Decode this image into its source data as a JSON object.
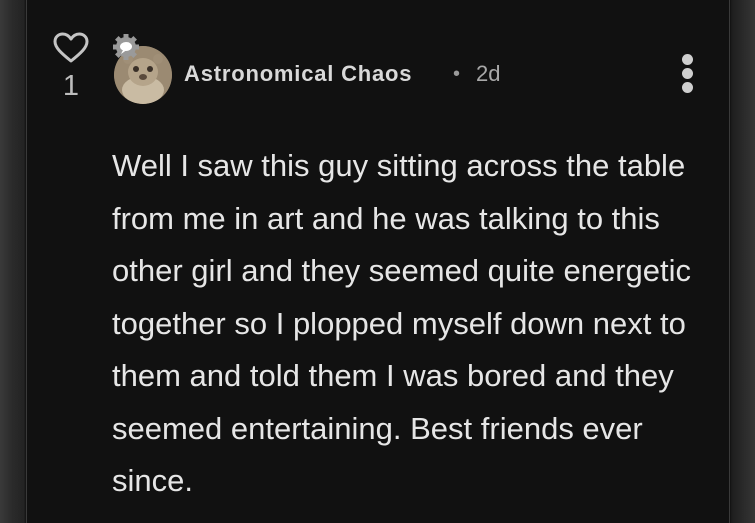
{
  "comment": {
    "likes": "1",
    "author": "Astronomical Chaos",
    "separator": "•",
    "time_ago": "2d",
    "body": "Well I saw this guy sitting across the table from me in art and he was talking to this other girl and they seemed quite energetic together so I plopped myself down next to them and told them I was bored and they seemed entertaining. Best friends ever since."
  },
  "icons": {
    "like": "heart-outline-icon",
    "badge": "gear-chat-badge-icon",
    "menu": "vertical-ellipsis-icon"
  },
  "colors": {
    "background": "#111111",
    "text": "#e6e6e6",
    "muted": "#a8a8a8"
  }
}
